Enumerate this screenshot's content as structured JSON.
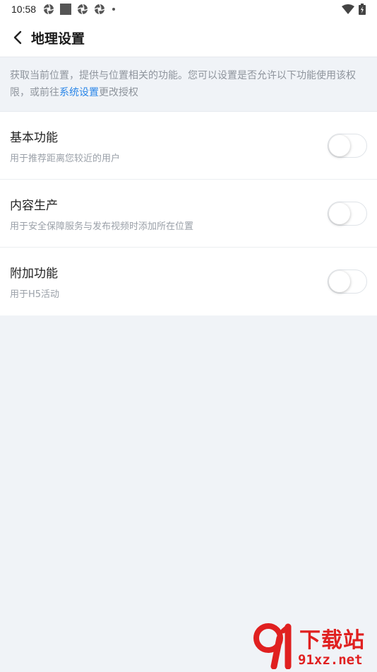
{
  "status_bar": {
    "time": "10:58"
  },
  "header": {
    "title": "地理设置"
  },
  "notice": {
    "text_before": "获取当前位置，提供与位置相关的功能。您可以设置是否允许以下功能使用该权限，或前往",
    "link_text": "系统设置",
    "text_after": "更改授权"
  },
  "settings": [
    {
      "title": "基本功能",
      "desc": "用于推荐距离您较近的用户",
      "enabled": false
    },
    {
      "title": "内容生产",
      "desc": "用于安全保障服务与发布视频时添加所在位置",
      "enabled": false
    },
    {
      "title": "附加功能",
      "desc": "用于H5活动",
      "enabled": false
    }
  ],
  "watermark": {
    "top": "下载站",
    "bottom": "91xz.net"
  },
  "colors": {
    "accent_link": "#2a86e8",
    "page_background": "#f0f3f7",
    "watermark_red": "#e02020"
  }
}
